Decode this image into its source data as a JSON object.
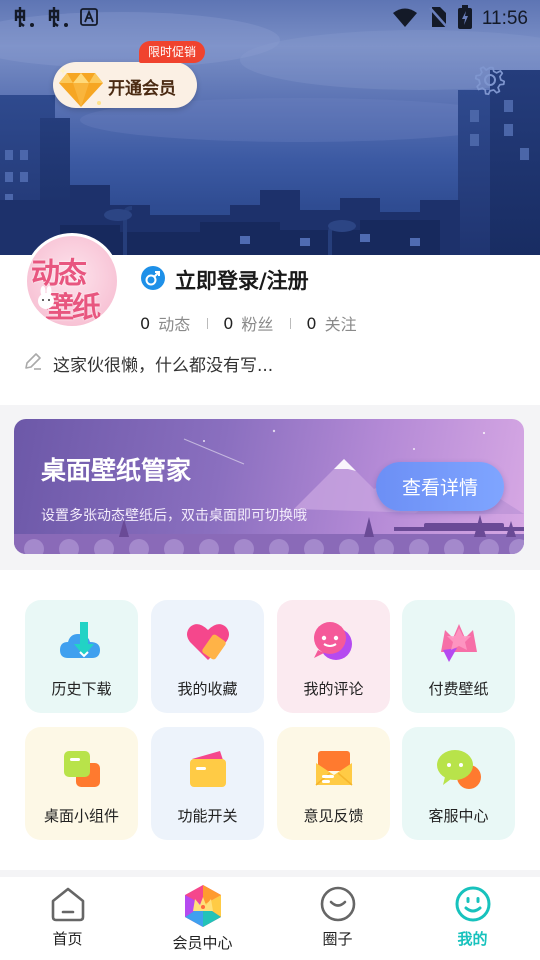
{
  "status_bar": {
    "time": "11:56"
  },
  "header": {
    "vip_button_label": "开通会员",
    "promo_badge": "限时促销"
  },
  "profile": {
    "avatar_text_line1": "动态",
    "avatar_text_line2": "壁纸",
    "login_title": "立即登录/注册",
    "stats": [
      {
        "value": "0",
        "label": "动态"
      },
      {
        "value": "0",
        "label": "粉丝"
      },
      {
        "value": "0",
        "label": "关注"
      }
    ],
    "bio": "这家伙很懒，什么都没有写..."
  },
  "banner": {
    "title": "桌面壁纸管家",
    "subtitle": "设置多张动态壁纸后，双击桌面即可切换哦",
    "cta_label": "查看详情"
  },
  "features": [
    {
      "label": "历史下载",
      "icon": "download-cloud-icon",
      "bg": "#e9f8f6"
    },
    {
      "label": "我的收藏",
      "icon": "heart-icon",
      "bg": "#edf3fb"
    },
    {
      "label": "我的评论",
      "icon": "comment-bubble-icon",
      "bg": "#fbeaf0"
    },
    {
      "label": "付费壁纸",
      "icon": "crown-star-icon",
      "bg": "#e9f8f6"
    },
    {
      "label": "桌面小组件",
      "icon": "widget-icon",
      "bg": "#fdf8e6"
    },
    {
      "label": "功能开关",
      "icon": "wallet-icon",
      "bg": "#edf3fb"
    },
    {
      "label": "意见反馈",
      "icon": "feedback-envelope-icon",
      "bg": "#fdf8e6"
    },
    {
      "label": "客服中心",
      "icon": "customer-service-chat-icon",
      "bg": "#e9f8f6"
    }
  ],
  "bottom_nav": [
    {
      "label": "首页",
      "icon": "home-icon",
      "active": false
    },
    {
      "label": "会员中心",
      "icon": "vip-crown-icon",
      "active": false
    },
    {
      "label": "圈子",
      "icon": "circle-face-icon",
      "active": false
    },
    {
      "label": "我的",
      "icon": "profile-smile-icon",
      "active": true
    }
  ],
  "colors": {
    "accent": "#17c2bd",
    "promo": "#f0432e",
    "cta": "#7296f7"
  }
}
